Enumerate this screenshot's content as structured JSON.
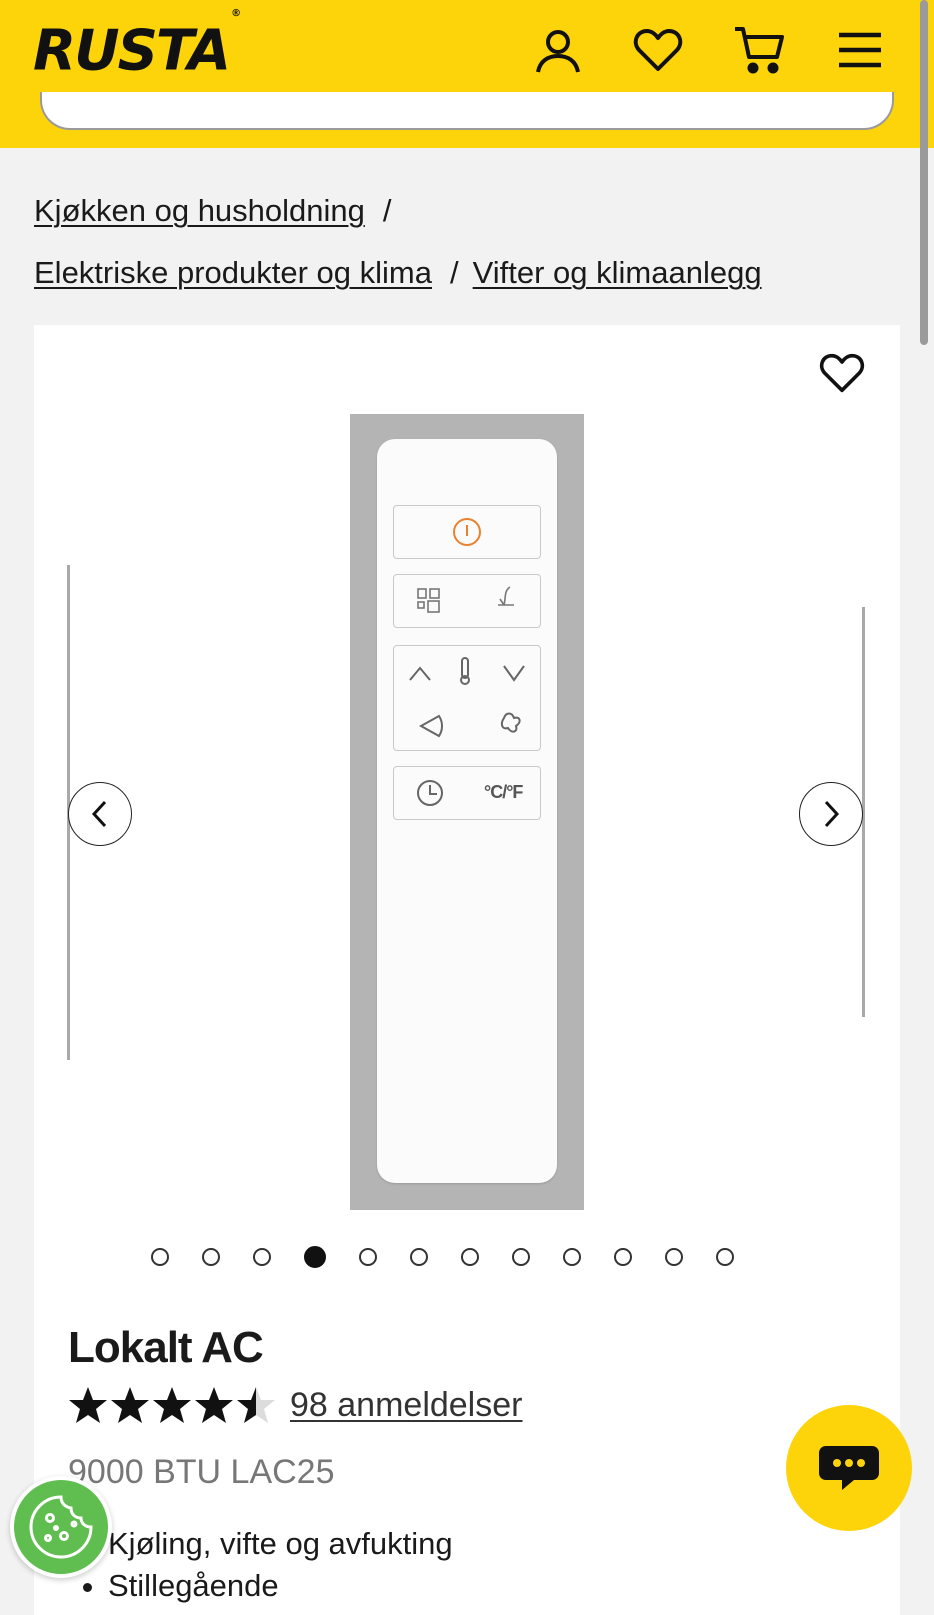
{
  "header": {
    "logo_text": "RUSTA",
    "logo_mark": "®",
    "icons": [
      "account-icon",
      "wishlist-heart-icon",
      "cart-icon",
      "menu-icon"
    ],
    "brand_color": "#fdd30a"
  },
  "breadcrumb": {
    "items": [
      {
        "label": "Kjøkken og husholdning"
      },
      {
        "label": "Elektriske produkter og klima"
      },
      {
        "label": "Vifter og klimaanlegg"
      }
    ],
    "separator": "/"
  },
  "gallery": {
    "image_count": 12,
    "active_index": 4,
    "remote_labels": {
      "temp_unit": "°C/°F"
    }
  },
  "product": {
    "title": "Lokalt AC",
    "rating": 4.5,
    "reviews_label": "98 anmeldelser",
    "variant": "9000 BTU LAC25",
    "features": [
      "Kjøling, vifte og avfukting",
      "Stillegående"
    ]
  },
  "widgets": {
    "cookie_icon": "cookie-icon",
    "chat_icon": "chat-icon"
  }
}
